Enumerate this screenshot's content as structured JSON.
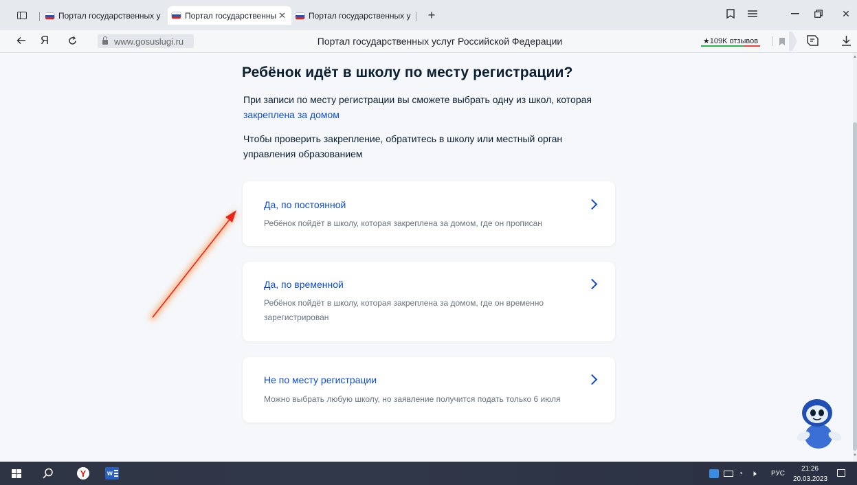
{
  "browser": {
    "tabs": [
      {
        "title": "Портал государственных у"
      },
      {
        "title": "Портал государственны"
      },
      {
        "title": "Портал государственных у"
      }
    ],
    "new_tab_symbol": "+",
    "yandex_letter": "Я",
    "url": "www.gosuslugi.ru",
    "page_title": "Портал государственных услуг Российской Федерации",
    "reviews_badge": "★109K отзывов"
  },
  "page": {
    "heading": "Ребёнок идёт в школу по месту регистрации?",
    "intro_text": "При записи по месту регистрации вы сможете выбрать одну из школ, которая ",
    "intro_link": "закреплена за домом",
    "check_text": "Чтобы проверить закрепление, обратитесь в школу или местный орган управления образованием",
    "options": [
      {
        "title": "Да, по постоянной",
        "description": "Ребёнок пойдёт в школу, которая закреплена за домом, где он прописан"
      },
      {
        "title": "Да, по временной",
        "description": "Ребёнок пойдёт в школу, которая закреплена за домом, где он временно зарегистрирован"
      },
      {
        "title": "Не по месту регистрации",
        "description": "Можно выбрать любую школу, но заявление получится подать только 6 июля"
      }
    ]
  },
  "colors": {
    "link": "#0d4cd3",
    "heading": "#0b1f33",
    "annotation_arrow": "#e8261c"
  },
  "taskbar": {
    "word_icon_label": "w",
    "language": "РУС",
    "time": "21:26",
    "date": "20.03.2023"
  }
}
